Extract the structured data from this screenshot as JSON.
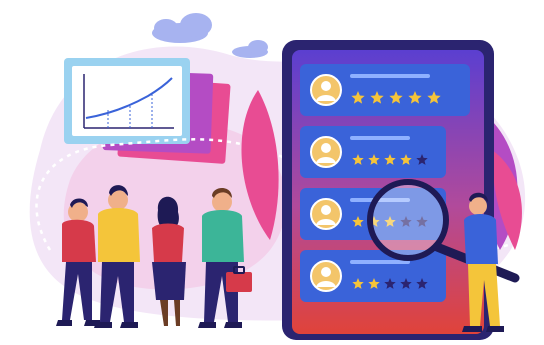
{
  "colors": {
    "background": "#ffffff",
    "blob": "#f3e6f7",
    "blob_pink": "#f4a9d4",
    "cloud": "#a7b3f0",
    "tablet_frame": "#2b2470",
    "tablet_screen_top": "#5b3fd0",
    "tablet_screen_bottom": "#e0433a",
    "card": "#3a63d9",
    "avatar_bg": "#f3c56a",
    "star_on": "#f5c43a",
    "star_off": "#2b2470",
    "leaf_pink": "#e84c93",
    "leaf_purple": "#b44cc4",
    "chart_board": "#9ad2f0",
    "chart_paper": "#ffffff",
    "line_accent": "#3a63d9",
    "magnifier_frame": "#1e1a55",
    "skin": "#f0b08a",
    "skin_dark": "#6b3d25"
  },
  "review_cards": [
    {
      "stars": 5,
      "rating": 5
    },
    {
      "stars": 5,
      "rating": 4
    },
    {
      "stars": 5,
      "rating": 3
    },
    {
      "stars": 5,
      "rating": 2
    }
  ],
  "trend_chart": {
    "points": 4,
    "trend": "rising"
  },
  "people": [
    {
      "role": "man-red-sweater"
    },
    {
      "role": "man-yellow-sweater"
    },
    {
      "role": "woman-red-top"
    },
    {
      "role": "man-green-sweater-briefcase"
    },
    {
      "role": "man-with-magnifier"
    }
  ],
  "icons": [
    "star-icon",
    "user-avatar-icon",
    "magnifier-icon",
    "cloud-icon",
    "briefcase-icon",
    "leaf-icon"
  ]
}
